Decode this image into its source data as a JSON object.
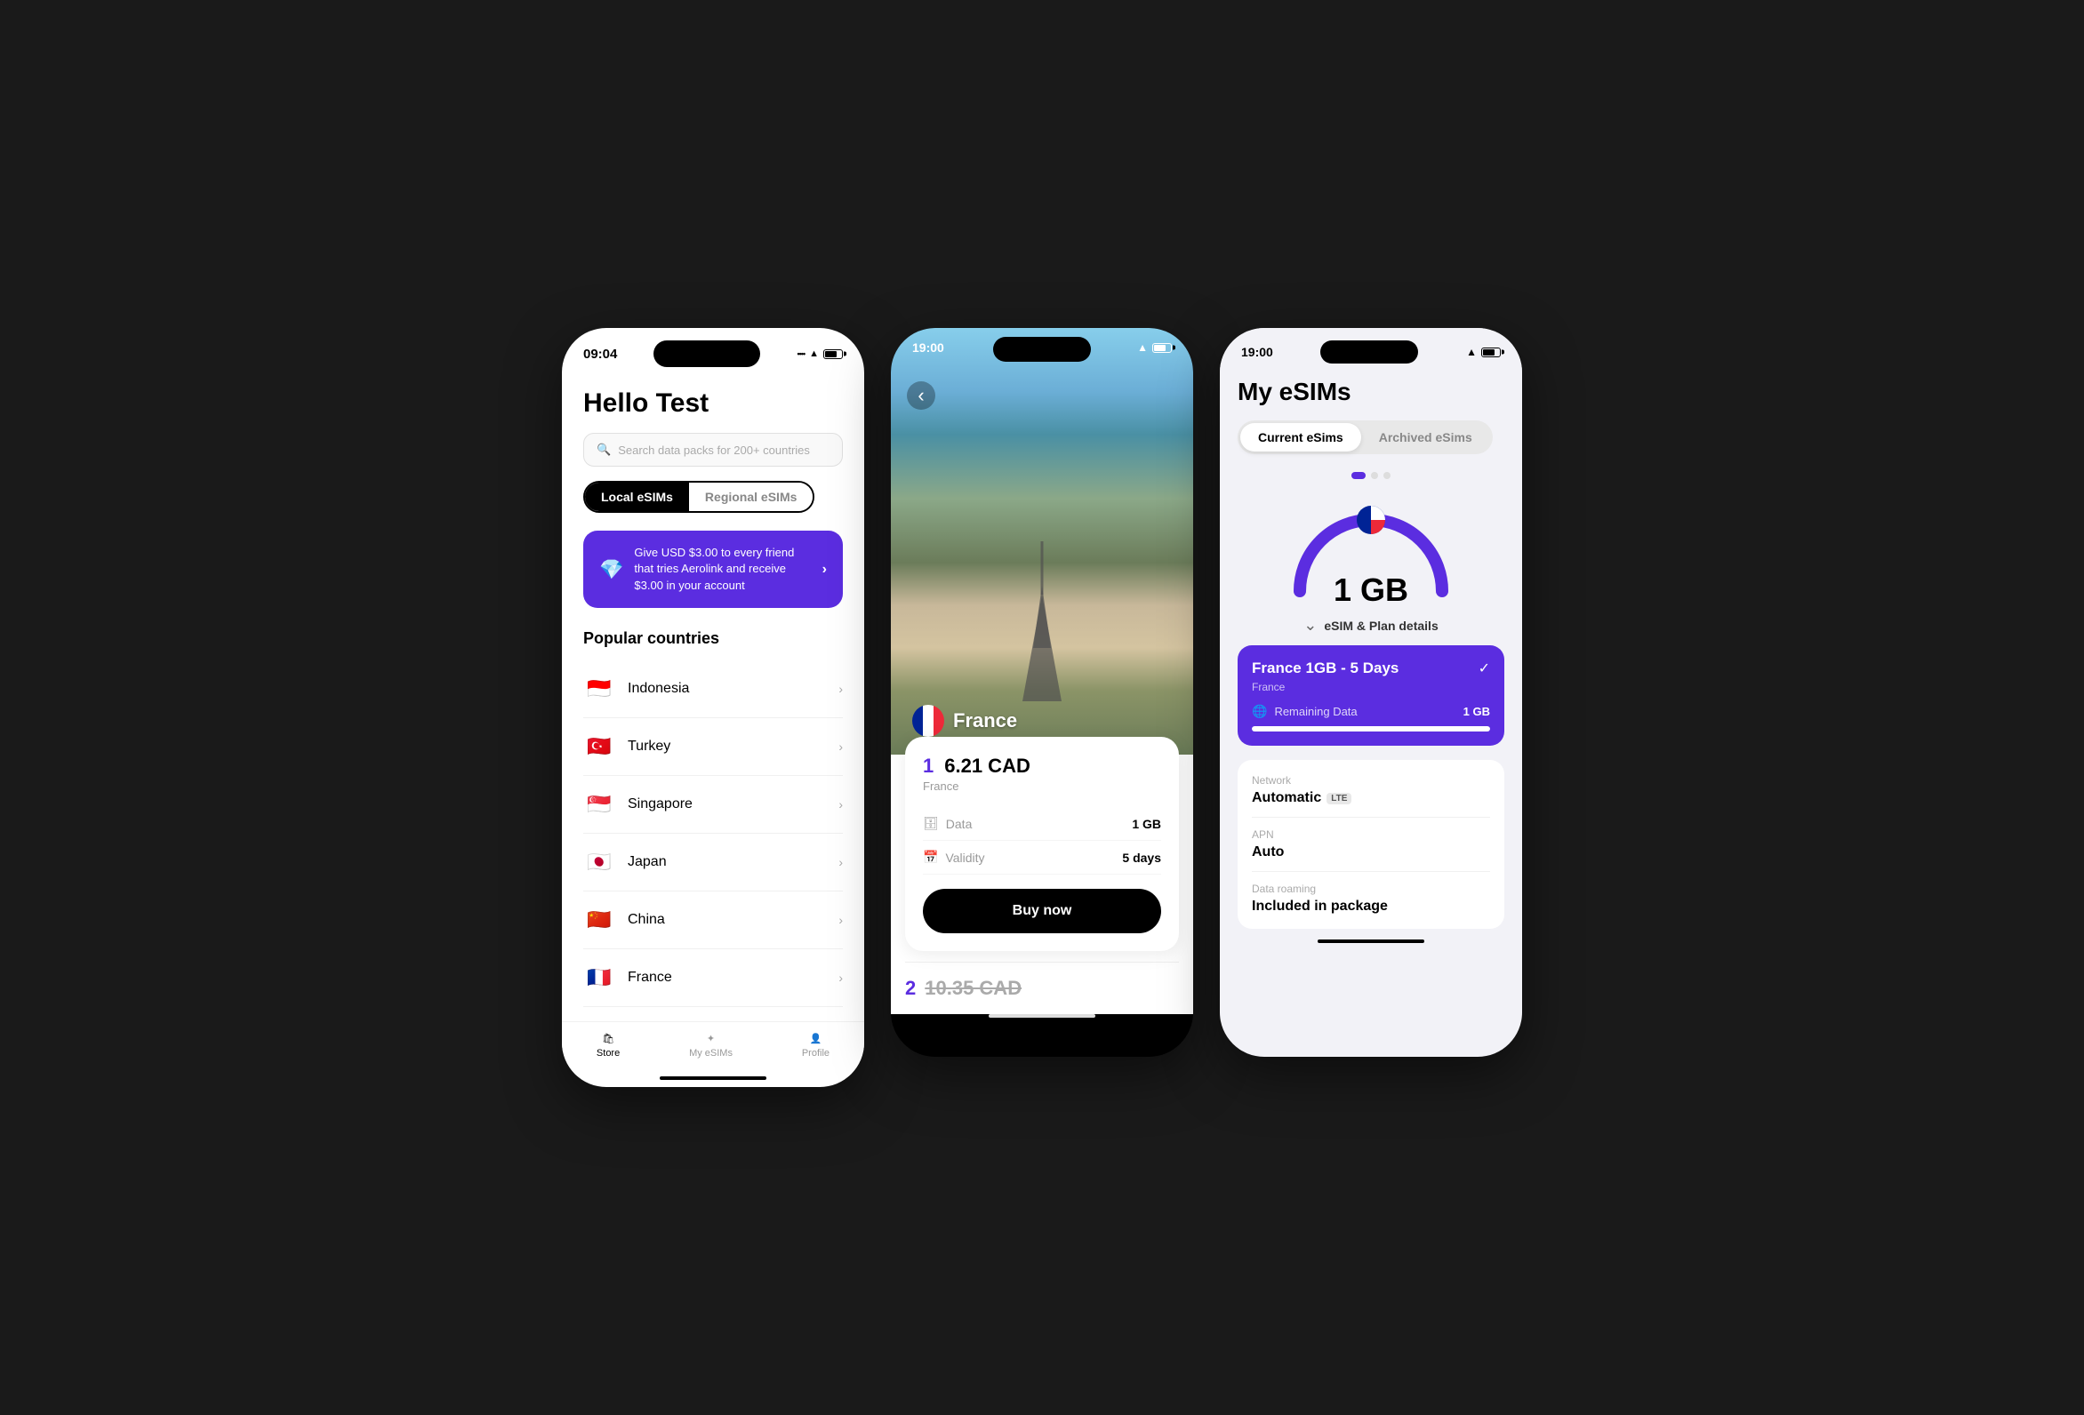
{
  "phone1": {
    "status": {
      "time": "09:04",
      "signal": "....",
      "wifi": "WiFi",
      "battery": "Battery"
    },
    "greeting": "Hello Test",
    "search_placeholder": "Search data packs for 200+ countries",
    "tabs": [
      "Local eSIMs",
      "Regional eSIMs"
    ],
    "promo_text": "Give USD $3.00 to every friend that tries Aerolink and receive $3.00 in your account",
    "popular_title": "Popular countries",
    "countries": [
      {
        "name": "Indonesia",
        "flag": "🇮🇩"
      },
      {
        "name": "Turkey",
        "flag": "🇹🇷"
      },
      {
        "name": "Singapore",
        "flag": "🇸🇬"
      },
      {
        "name": "Japan",
        "flag": "🇯🇵"
      },
      {
        "name": "China",
        "flag": "🇨🇳"
      },
      {
        "name": "France",
        "flag": "🇫🇷"
      }
    ],
    "nav": [
      {
        "label": "Store",
        "icon": "🛍",
        "active": true
      },
      {
        "label": "My eSIMs",
        "icon": "✦",
        "active": false
      },
      {
        "label": "Profile",
        "icon": "👤",
        "active": false
      }
    ]
  },
  "phone2": {
    "status": {
      "time": "19:00"
    },
    "country": "France",
    "plans": [
      {
        "rank": "1",
        "price": "6.21 CAD",
        "country_label": "France",
        "data": "1 GB",
        "validity": "5 days",
        "buy_label": "Buy now"
      },
      {
        "rank": "2",
        "price": "10.35 CAD"
      }
    ]
  },
  "phone3": {
    "status": {
      "time": "19:00"
    },
    "title": "My eSIMs",
    "tabs": {
      "current": "Current eSims",
      "archived": "Archived eSims"
    },
    "dots": [
      true,
      false,
      false
    ],
    "gauge": {
      "value": "1 GB",
      "sub": "eSIM & Plan details"
    },
    "active_plan": {
      "title": "France 1GB - 5 Days",
      "country": "France",
      "data_label": "Remaining Data",
      "data_value": "1 GB",
      "bar_fill": 100
    },
    "details": [
      {
        "label": "Network",
        "value": "Automatic",
        "badge": "LTE"
      },
      {
        "label": "APN",
        "value": "Auto",
        "badge": null
      },
      {
        "label": "Data roaming",
        "value": "Included in package",
        "badge": null
      }
    ]
  }
}
